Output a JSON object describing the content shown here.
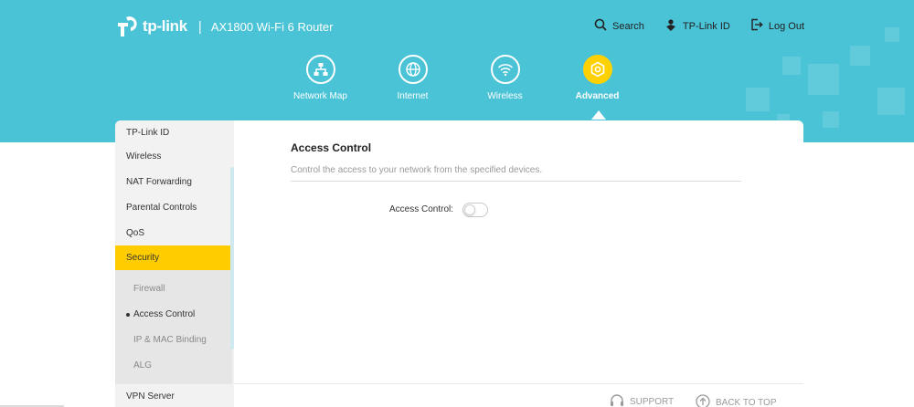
{
  "header": {
    "brand": "tp-link",
    "model": "AX1800 Wi-Fi 6 Router",
    "separator": "|"
  },
  "topnav": {
    "search": "Search",
    "tplink_id": "TP-Link ID",
    "logout": "Log Out"
  },
  "mainnav": {
    "tabs": [
      {
        "label": "Network Map",
        "icon": "network-map-icon"
      },
      {
        "label": "Internet",
        "icon": "globe-icon"
      },
      {
        "label": "Wireless",
        "icon": "wifi-icon"
      },
      {
        "label": "Advanced",
        "icon": "gear-icon",
        "active": true
      }
    ]
  },
  "sidebar": {
    "items": [
      "TP-Link ID",
      "Wireless",
      "NAT Forwarding",
      "Parental Controls",
      "QoS",
      "Security",
      "VPN Server"
    ],
    "active": "Security",
    "subitems": [
      "Firewall",
      "Access Control",
      "IP & MAC Binding",
      "ALG"
    ],
    "active_subitem": "Access Control"
  },
  "content": {
    "title": "Access Control",
    "description": "Control the access to your network from the specified devices.",
    "toggle_label": "Access Control:",
    "toggle_on": false
  },
  "footer": {
    "support": "SUPPORT",
    "back_to_top": "BACK TO TOP"
  },
  "colors": {
    "banner": "#4ac3d6",
    "accent": "#ffcc00",
    "active_tab": "#ffd100"
  }
}
